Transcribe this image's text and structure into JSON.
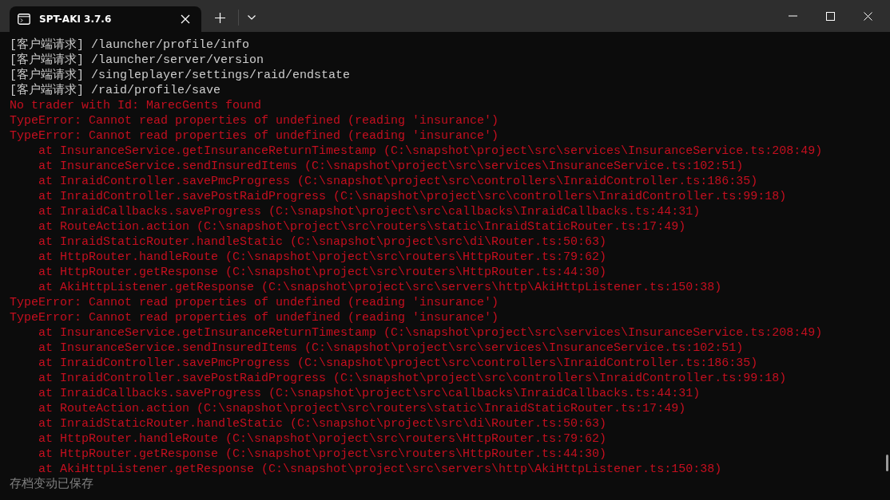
{
  "window": {
    "tab": {
      "title": "SPT-AKI 3.7.6",
      "selected": true
    }
  },
  "lines": [
    {
      "kind": "request",
      "text": "[客户端请求] /launcher/profile/info"
    },
    {
      "kind": "request",
      "text": "[客户端请求] /launcher/server/version"
    },
    {
      "kind": "request",
      "text": "[客户端请求] /singleplayer/settings/raid/endstate"
    },
    {
      "kind": "request",
      "text": "[客户端请求] /raid/profile/save"
    },
    {
      "kind": "error",
      "text": "No trader with Id: MarecGents found"
    },
    {
      "kind": "error",
      "text": "TypeError: Cannot read properties of undefined (reading 'insurance')"
    },
    {
      "kind": "error",
      "text": "TypeError: Cannot read properties of undefined (reading 'insurance')"
    },
    {
      "kind": "trace",
      "text": "at InsuranceService.getInsuranceReturnTimestamp (C:\\snapshot\\project\\src\\services\\InsuranceService.ts:208:49)"
    },
    {
      "kind": "trace",
      "text": "at InsuranceService.sendInsuredItems (C:\\snapshot\\project\\src\\services\\InsuranceService.ts:102:51)"
    },
    {
      "kind": "trace",
      "text": "at InraidController.savePmcProgress (C:\\snapshot\\project\\src\\controllers\\InraidController.ts:186:35)"
    },
    {
      "kind": "trace",
      "text": "at InraidController.savePostRaidProgress (C:\\snapshot\\project\\src\\controllers\\InraidController.ts:99:18)"
    },
    {
      "kind": "trace",
      "text": "at InraidCallbacks.saveProgress (C:\\snapshot\\project\\src\\callbacks\\InraidCallbacks.ts:44:31)"
    },
    {
      "kind": "trace",
      "text": "at RouteAction.action (C:\\snapshot\\project\\src\\routers\\static\\InraidStaticRouter.ts:17:49)"
    },
    {
      "kind": "trace",
      "text": "at InraidStaticRouter.handleStatic (C:\\snapshot\\project\\src\\di\\Router.ts:50:63)"
    },
    {
      "kind": "trace",
      "text": "at HttpRouter.handleRoute (C:\\snapshot\\project\\src\\routers\\HttpRouter.ts:79:62)"
    },
    {
      "kind": "trace",
      "text": "at HttpRouter.getResponse (C:\\snapshot\\project\\src\\routers\\HttpRouter.ts:44:30)"
    },
    {
      "kind": "trace",
      "text": "at AkiHttpListener.getResponse (C:\\snapshot\\project\\src\\servers\\http\\AkiHttpListener.ts:150:38)"
    },
    {
      "kind": "error",
      "text": "TypeError: Cannot read properties of undefined (reading 'insurance')"
    },
    {
      "kind": "error",
      "text": "TypeError: Cannot read properties of undefined (reading 'insurance')"
    },
    {
      "kind": "trace",
      "text": "at InsuranceService.getInsuranceReturnTimestamp (C:\\snapshot\\project\\src\\services\\InsuranceService.ts:208:49)"
    },
    {
      "kind": "trace",
      "text": "at InsuranceService.sendInsuredItems (C:\\snapshot\\project\\src\\services\\InsuranceService.ts:102:51)"
    },
    {
      "kind": "trace",
      "text": "at InraidController.savePmcProgress (C:\\snapshot\\project\\src\\controllers\\InraidController.ts:186:35)"
    },
    {
      "kind": "trace",
      "text": "at InraidController.savePostRaidProgress (C:\\snapshot\\project\\src\\controllers\\InraidController.ts:99:18)"
    },
    {
      "kind": "trace",
      "text": "at InraidCallbacks.saveProgress (C:\\snapshot\\project\\src\\callbacks\\InraidCallbacks.ts:44:31)"
    },
    {
      "kind": "trace",
      "text": "at RouteAction.action (C:\\snapshot\\project\\src\\routers\\static\\InraidStaticRouter.ts:17:49)"
    },
    {
      "kind": "trace",
      "text": "at InraidStaticRouter.handleStatic (C:\\snapshot\\project\\src\\di\\Router.ts:50:63)"
    },
    {
      "kind": "trace",
      "text": "at HttpRouter.handleRoute (C:\\snapshot\\project\\src\\routers\\HttpRouter.ts:79:62)"
    },
    {
      "kind": "trace",
      "text": "at HttpRouter.getResponse (C:\\snapshot\\project\\src\\routers\\HttpRouter.ts:44:30)"
    },
    {
      "kind": "trace",
      "text": "at AkiHttpListener.getResponse (C:\\snapshot\\project\\src\\servers\\http\\AkiHttpListener.ts:150:38)"
    },
    {
      "kind": "info",
      "text": "存档变动已保存"
    }
  ]
}
